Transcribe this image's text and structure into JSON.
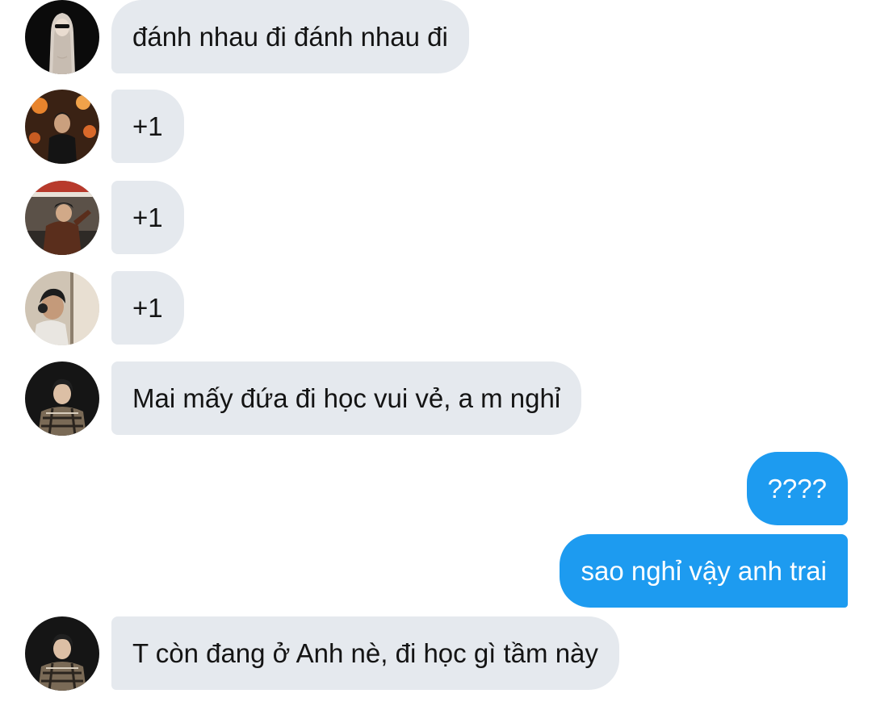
{
  "colors": {
    "incoming_bubble": "#e5e9ee",
    "outgoing_bubble": "#1d9bf0",
    "incoming_text": "#141414",
    "outgoing_text": "#ffffff"
  },
  "messages": [
    {
      "direction": "incoming",
      "text": "đánh nhau đi đánh nhau đi",
      "avatar": "user-avatar-1"
    },
    {
      "direction": "incoming",
      "text": "+1",
      "avatar": "user-avatar-2"
    },
    {
      "direction": "incoming",
      "text": "+1",
      "avatar": "user-avatar-3"
    },
    {
      "direction": "incoming",
      "text": "+1",
      "avatar": "user-avatar-4"
    },
    {
      "direction": "incoming",
      "text": "Mai mấy đứa đi học vui vẻ, a m nghỉ",
      "avatar": "user-avatar-5"
    },
    {
      "direction": "outgoing",
      "text": "????"
    },
    {
      "direction": "outgoing",
      "text": "sao nghỉ vậy anh trai"
    },
    {
      "direction": "incoming",
      "text": "T còn đang ở Anh nè, đi học gì tầm này",
      "avatar": "user-avatar-5"
    }
  ]
}
